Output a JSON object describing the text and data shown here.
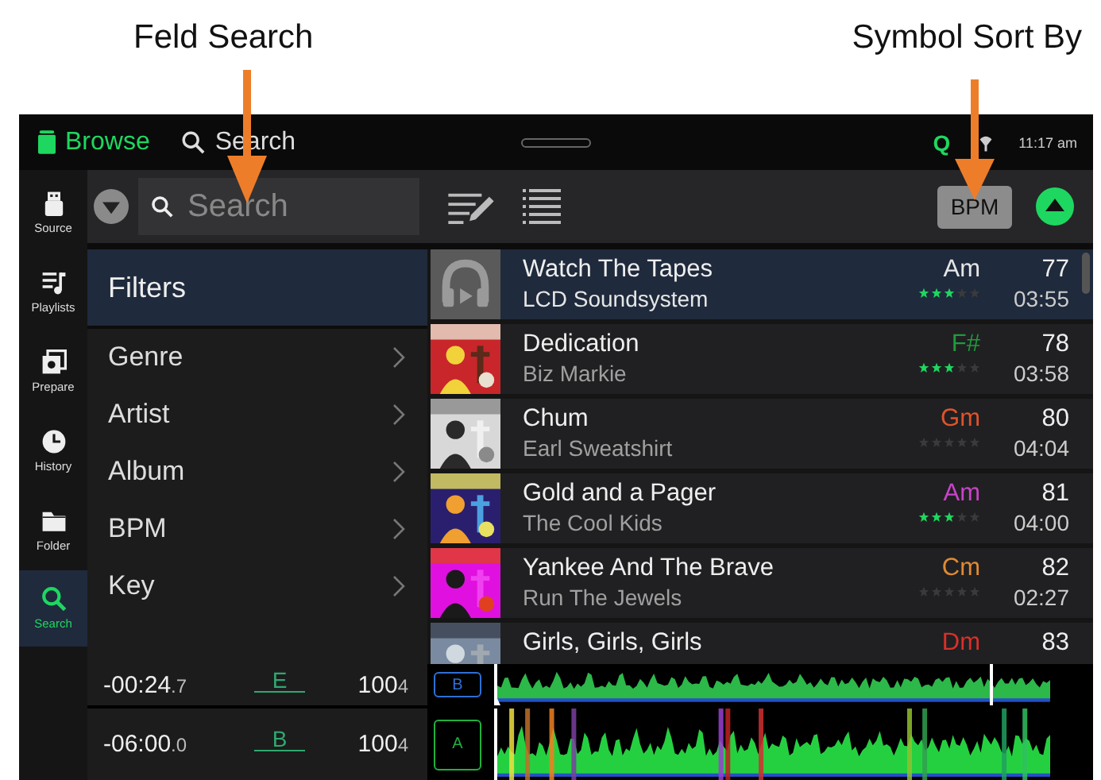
{
  "annotations": [
    {
      "label": "Feld Search"
    },
    {
      "label": "Symbol Sort By"
    }
  ],
  "top_bar": {
    "browse": "Browse",
    "search": "Search",
    "quantize": "Q",
    "time": "11:17 am"
  },
  "toolbar": {
    "search_placeholder": "Search",
    "sort": "BPM"
  },
  "sidebar": [
    {
      "label": "Source",
      "kind": "usb",
      "selected": false
    },
    {
      "label": "Playlists",
      "kind": "playlist",
      "selected": false
    },
    {
      "label": "Prepare",
      "kind": "prepare",
      "selected": false
    },
    {
      "label": "History",
      "kind": "history",
      "selected": false
    },
    {
      "label": "Folder",
      "kind": "folder",
      "selected": false
    },
    {
      "label": "Search",
      "kind": "search",
      "selected": true
    }
  ],
  "filters": {
    "title": "Filters",
    "items": [
      "Genre",
      "Artist",
      "Album",
      "BPM",
      "Key"
    ]
  },
  "tracks": [
    {
      "title": "Watch The Tapes",
      "artist": "LCD Soundsystem",
      "key": "Am",
      "color": "#e6e6e6",
      "bpm": "77",
      "length": "03:55",
      "stars": 3,
      "kind": "placeholder",
      "selected": true
    },
    {
      "title": "Dedication",
      "artist": "Biz Markie",
      "key": "F#",
      "color": "#1f9a3c",
      "bpm": "78",
      "length": "03:58",
      "stars": 3,
      "kind": "picture",
      "selected": false
    },
    {
      "title": "Chum",
      "artist": "Earl Sweatshirt",
      "key": "Gm",
      "color": "#e0532b",
      "bpm": "80",
      "length": "04:04",
      "stars": 0,
      "kind": "picture",
      "selected": false
    },
    {
      "title": "Gold and a Pager",
      "artist": "The Cool Kids",
      "key": "Am",
      "color": "#c943c9",
      "bpm": "81",
      "length": "04:00",
      "stars": 3,
      "kind": "picture",
      "selected": false
    },
    {
      "title": "Yankee And The Brave",
      "artist": "Run The Jewels",
      "key": "Cm",
      "color": "#e08a33",
      "bpm": "82",
      "length": "02:27",
      "stars": 0,
      "kind": "picture",
      "selected": false
    },
    {
      "title": "Girls, Girls, Girls",
      "key": "Dm",
      "color": "#d8302a",
      "bpm": "83",
      "kind": "picture",
      "selected": false
    }
  ],
  "decks": [
    {
      "deck": "B",
      "color": "#2e6fd6",
      "time": "-00:24",
      "time_fraction": ".7",
      "key": "E",
      "bpm": "100",
      "bpm_fraction": "4"
    },
    {
      "deck": "A",
      "color": "#20b040",
      "time": "-06:00",
      "time_fraction": ".0",
      "key": "B",
      "bpm": "100",
      "bpm_fraction": "4"
    }
  ]
}
